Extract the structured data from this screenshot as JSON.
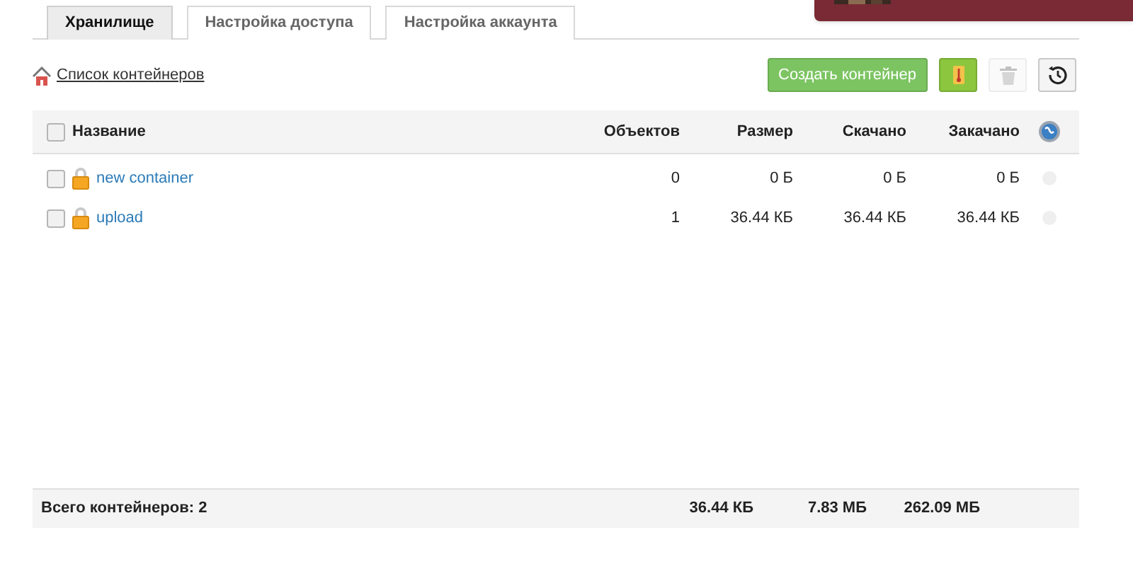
{
  "tabs": [
    {
      "label": "Хранилище",
      "selected": true
    },
    {
      "label": "Настройка доступа",
      "selected": false
    },
    {
      "label": "Настройка аккаунта",
      "selected": false
    }
  ],
  "breadcrumb": "Список контейнеров",
  "toolbar": {
    "create_button": "Создать контейнер",
    "delete_disabled": true
  },
  "table": {
    "select_all_checked": false,
    "columns": [
      "Название",
      "Объектов",
      "Размер",
      "Скачано",
      "Закачано"
    ],
    "rows": [
      {
        "checked": false,
        "name": "new container",
        "objects": "0",
        "size": "0 Б",
        "downloaded": "0 Б",
        "uploaded": "0 Б"
      },
      {
        "checked": false,
        "name": "upload",
        "objects": "1",
        "size": "36.44 КБ",
        "downloaded": "36.44 КБ",
        "uploaded": "36.44 КБ"
      }
    ]
  },
  "footer": {
    "total": "Всего контейнеров: 2",
    "size": "36.44 КБ",
    "downloaded": "7.83 МБ",
    "uploaded": "262.09 МБ"
  }
}
